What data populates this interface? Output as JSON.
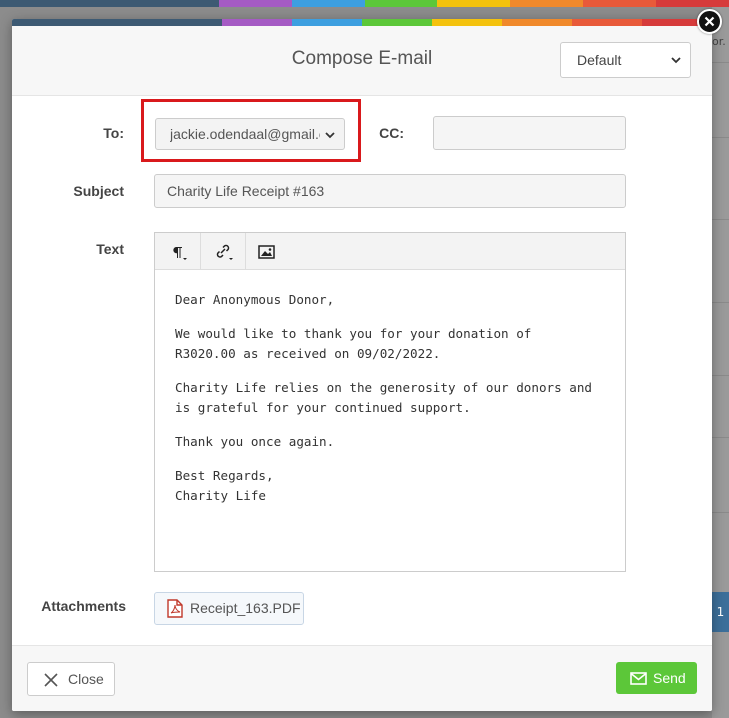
{
  "colors": {
    "accent_strip": [
      "#3d5a73",
      "#3d5a73",
      "#3d5a73",
      "#a55bc4",
      "#3d9fe0",
      "#5cc739",
      "#f4c20d",
      "#f0892b",
      "#e85a3a",
      "#d63b3b"
    ],
    "send_green": "#5cc739",
    "highlight_red": "#d9191c"
  },
  "background": {
    "side_text": "or.",
    "side_tag": "1"
  },
  "modal": {
    "title": "Compose E-mail",
    "template_select": {
      "value": "Default",
      "icon": "chevron-down-icon"
    },
    "to": {
      "label": "To:",
      "value": "jackie.odendaal@gmail.com"
    },
    "cc": {
      "label": "CC:",
      "value": ""
    },
    "subject": {
      "label": "Subject",
      "value": "Charity Life Receipt #163"
    },
    "text": {
      "label": "Text",
      "toolbar": [
        "paragraph-icon",
        "link-icon",
        "image-icon"
      ],
      "body": [
        "Dear Anonymous Donor,",
        "We would like to thank you for your donation of R3020.00 as received on 09/02/2022.",
        "Charity Life relies on the generosity of our donors and is grateful for your continued support.",
        "Thank you once again.",
        "Best Regards,",
        "Charity Life"
      ]
    },
    "attachments": {
      "label": "Attachments",
      "file": "Receipt_163.PDF"
    },
    "footer": {
      "close_label": "Close",
      "send_label": "Send"
    }
  }
}
